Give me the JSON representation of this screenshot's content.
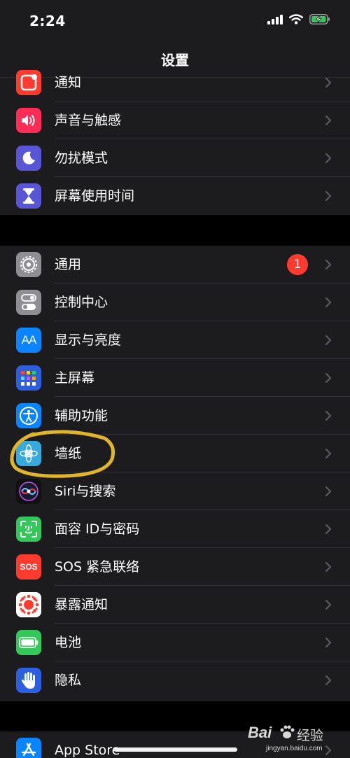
{
  "status_bar": {
    "time": "2:24"
  },
  "nav": {
    "title": "设置"
  },
  "group1": [
    {
      "label": "通知",
      "icon": "notifications-icon",
      "color": "#ff3b30"
    },
    {
      "label": "声音与触感",
      "icon": "speaker-icon",
      "color": "#ff2d55"
    },
    {
      "label": "勿扰模式",
      "icon": "moon-icon",
      "color": "#5856d6"
    },
    {
      "label": "屏幕使用时间",
      "icon": "hourglass-icon",
      "color": "#5856d6"
    }
  ],
  "group2": [
    {
      "label": "通用",
      "icon": "gear-icon",
      "color": "#8e8e93",
      "badge": "1"
    },
    {
      "label": "控制中心",
      "icon": "toggles-icon",
      "color": "#8e8e93"
    },
    {
      "label": "显示与亮度",
      "icon": "text-size-icon",
      "color": "#0a84ff"
    },
    {
      "label": "主屏幕",
      "icon": "home-screen-grid-icon",
      "color": "#2c5fe0"
    },
    {
      "label": "辅助功能",
      "icon": "accessibility-icon",
      "color": "#0a84ff"
    },
    {
      "label": "墙纸",
      "icon": "flower-icon",
      "color": "#36aadc"
    },
    {
      "label": "Siri与搜索",
      "icon": "siri-icon",
      "color": "#111111"
    },
    {
      "label": "面容 ID与密码",
      "icon": "face-id-icon",
      "color": "#34c759"
    },
    {
      "label": "SOS 紧急联络",
      "icon": "sos-icon",
      "color": "#ff3b30"
    },
    {
      "label": "暴露通知",
      "icon": "exposure-icon",
      "color": "#ff3b30"
    },
    {
      "label": "电池",
      "icon": "battery-icon",
      "color": "#34c759"
    },
    {
      "label": "隐私",
      "icon": "hand-icon",
      "color": "#2c5fe0"
    }
  ],
  "group3": [
    {
      "label": "App Store",
      "icon": "app-store-icon",
      "color": "#0a84ff"
    }
  ],
  "icons": {
    "sos_text": "SOS",
    "text_size": "AA"
  },
  "watermark": {
    "brand": "Bai",
    "brand_cn": "经验",
    "url": "jingyan.baidu.com"
  },
  "colors": {
    "background": "#000000",
    "group_bg": "#1c1c1e",
    "separator": "#333337",
    "highlight_circle": "#e0b52a"
  }
}
